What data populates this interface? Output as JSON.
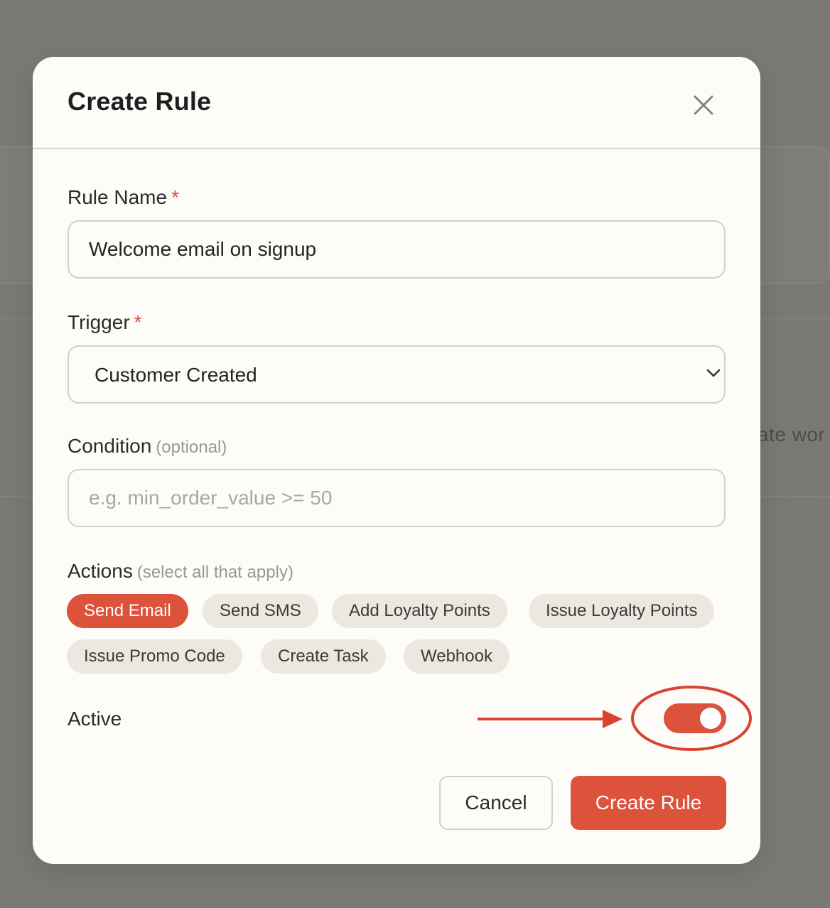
{
  "background": {
    "partial_text": "ate wor"
  },
  "modal": {
    "title": "Create Rule",
    "close_icon": "close-icon"
  },
  "form": {
    "rule_name": {
      "label": "Rule Name",
      "required_mark": "*",
      "value": "Welcome email on signup"
    },
    "trigger": {
      "label": "Trigger",
      "required_mark": "*",
      "selected": "Customer Created",
      "icon": "chevron-down-icon"
    },
    "condition": {
      "label": "Condition",
      "hint": "(optional)",
      "value": "",
      "placeholder": "e.g. min_order_value >= 50"
    },
    "actions": {
      "label": "Actions",
      "hint": "(select all that apply)",
      "items": [
        {
          "label": "Send Email",
          "selected": true
        },
        {
          "label": "Send SMS",
          "selected": false
        },
        {
          "label": "Add Loyalty Points",
          "selected": false
        },
        {
          "label": "Issue Loyalty Points",
          "selected": false
        },
        {
          "label": "Issue Promo Code",
          "selected": false
        },
        {
          "label": "Create Task",
          "selected": false
        },
        {
          "label": "Webhook",
          "selected": false
        }
      ]
    },
    "active": {
      "label": "Active",
      "on": true
    }
  },
  "buttons": {
    "cancel": "Cancel",
    "create": "Create Rule"
  },
  "colors": {
    "accent": "#dc523b",
    "chip_bg": "#ebe8e0",
    "overlay": "#7b7976",
    "modal_bg": "#fdfcf9"
  }
}
